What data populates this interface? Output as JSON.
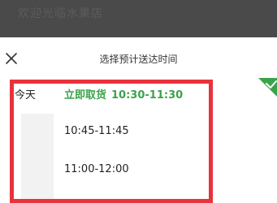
{
  "backdrop": {
    "title": "欢迎光临水果店"
  },
  "sheet": {
    "title": "选择预计送达时间"
  },
  "days": [
    {
      "label": "今天"
    }
  ],
  "slots": [
    {
      "prefix": "立即取货",
      "time": "10:30-11:30",
      "selected": true
    },
    {
      "time": "10:45-11:45"
    },
    {
      "time": "11:00-12:00"
    }
  ],
  "icons": {
    "close": "close-icon",
    "check": "check-icon"
  },
  "colors": {
    "accent_green": "#3aa34a",
    "highlight_red": "#e8323c",
    "backdrop": "#4a4a4a"
  }
}
